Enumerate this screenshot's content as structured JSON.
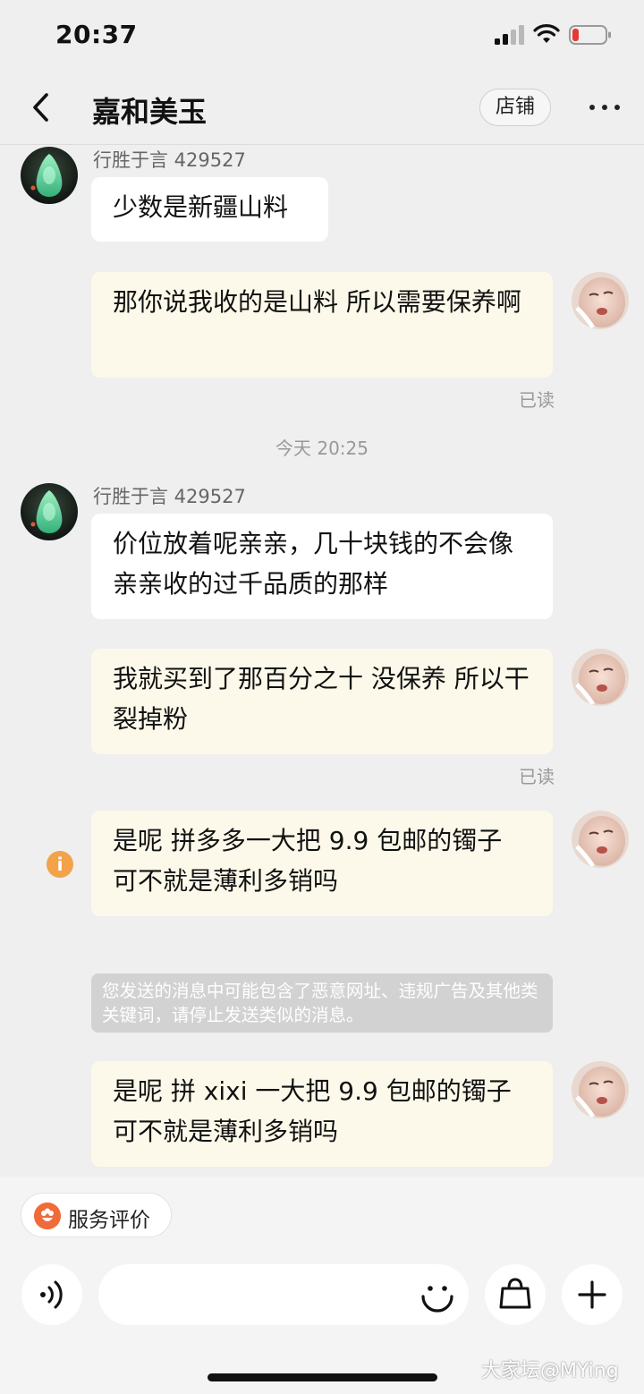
{
  "status_bar": {
    "time": "20:37",
    "battery_color": "#e53935"
  },
  "header": {
    "title": "嘉和美玉",
    "store_label": "店铺"
  },
  "messages": {
    "m1": {
      "sender": "行胜于言 429527",
      "text": "少数是新疆山料"
    },
    "m2": {
      "text": "那你说我收的是山料 所以需要保养啊",
      "status": "已读"
    },
    "time_divider": "今天 20:25",
    "m3": {
      "sender": "行胜于言 429527",
      "text": "价位放着呢亲亲，几十块钱的不会像亲亲收的过千品质的那样"
    },
    "m4": {
      "text": "我就买到了那百分之十 没保养 所以干裂掉粉",
      "status": "已读"
    },
    "m5": {
      "text": "是呢  拼多多一大把 9.9 包邮的镯子  可不就是薄利多销吗",
      "warning_icon": "i"
    },
    "system_note": "您发送的消息中可能包含了恶意网址、违规广告及其他类关键词，请停止发送类似的消息。",
    "m6": {
      "text": "是呢  拼 xixi 一大把 9.9 包邮的镯子  可不就是薄利多销吗"
    }
  },
  "bottom": {
    "rating_label": "服务评价",
    "input_placeholder": ""
  },
  "watermark": "大家坛@MYing",
  "colors": {
    "outgoing_bubble": "#fdf9ea",
    "incoming_bubble": "#ffffff",
    "warning": "#f2a34a",
    "rating_icon": "#f06a3a"
  }
}
